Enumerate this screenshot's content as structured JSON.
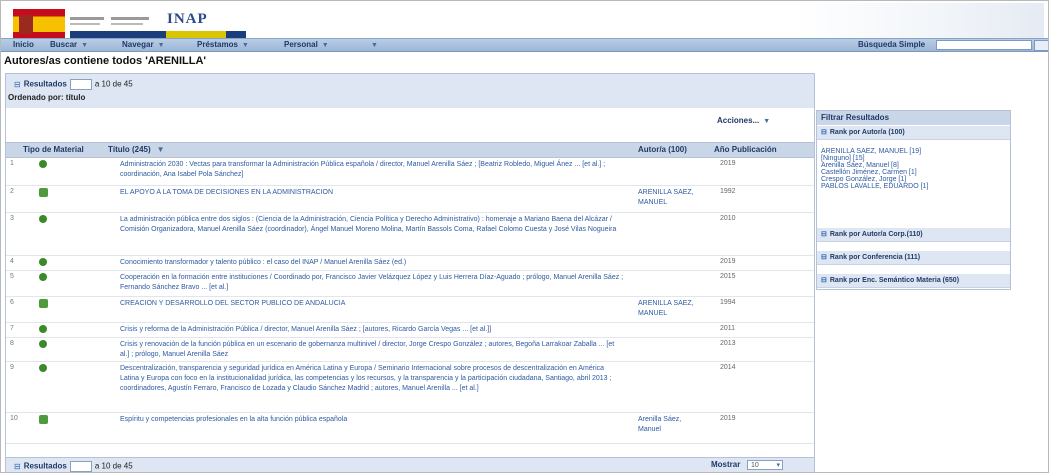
{
  "header": {
    "app_title": "INAP",
    "nav": [
      {
        "label": "Inicio",
        "dropdown": false
      },
      {
        "label": "Buscar",
        "dropdown": true
      },
      {
        "label": "Navegar",
        "dropdown": true
      },
      {
        "label": "Préstamos",
        "dropdown": true
      },
      {
        "label": "Personal",
        "dropdown": true
      },
      {
        "label": "",
        "dropdown": true
      }
    ],
    "dropdown_glyph": "▼",
    "search_label": "Búsqueda Simple",
    "search_value": ""
  },
  "page": {
    "heading": "Autores/as contiene todos 'ARENILLA'"
  },
  "results": {
    "collapse_glyph": "⊟",
    "label": "Resultados",
    "page_value": "1",
    "range": "a 10 de 45",
    "ordered_by": "Ordenado por: título",
    "actions_label": "Acciones..."
  },
  "table": {
    "headers": {
      "material": "Tipo de Material",
      "title": "Título (245)",
      "author": "Autor/a (100)",
      "year": "Año Publicación"
    },
    "rows": [
      {
        "num": "1",
        "icon": "book-icon",
        "title": "Administración 2030 : Vectas para transformar la Administración Pública española / director, Manuel Arenilla Sáez ; [Beatriz Robledo, Miguel Ánez ... [et al.] ; coordinación, Ana Isabel Pola Sánchez]",
        "author": "",
        "year": "2019"
      },
      {
        "num": "2",
        "icon": "printed-icon",
        "title": "EL APOYO A LA TOMA DE DECISIONES EN LA ADMINISTRACION",
        "author": "ARENILLA SAEZ, MANUEL",
        "year": "1992"
      },
      {
        "num": "3",
        "icon": "book-icon",
        "title": "La administración pública entre dos siglos : (Ciencia de la Administración, Ciencia Política y Derecho Administrativo) : homenaje a Mariano Baena del Alcázar / Comisión Organizadora, Manuel Arenilla Sáez (coordinador), Ángel Manuel Moreno Molina, Martín Bassols Coma, Rafael Colomo Cuesta y José Vilas Nogueira",
        "author": "",
        "year": "2010"
      },
      {
        "num": "4",
        "icon": "book-icon",
        "title": "Conocimiento transformador y talento público : el caso del INAP / Manuel Arenilla Sáez (ed.)",
        "author": "",
        "year": "2019"
      },
      {
        "num": "5",
        "icon": "book-icon",
        "title": "Cooperación en la formación entre instituciones / Coordinado por, Francisco Javier Velázquez López y Luis Herrera Díaz-Aguado ; prólogo, Manuel Arenilla Sáez ; Fernando Sánchez Bravo ... [et al.]",
        "author": "",
        "year": "2015"
      },
      {
        "num": "6",
        "icon": "printed-icon",
        "title": "CREACION Y DESARROLLO DEL SECTOR PUBLICO DE ANDALUCIA",
        "author": "ARENILLA SAEZ, MANUEL",
        "year": "1994"
      },
      {
        "num": "7",
        "icon": "book-icon",
        "title": "Crisis y reforma de la Administración Pública / director, Manuel Arenilla Sáez ; [autores, Ricardo García Vegas ... [et al.]]",
        "author": "",
        "year": "2011"
      },
      {
        "num": "8",
        "icon": "book-icon",
        "title": "Crisis y renovación de la función pública en un escenario de gobernanza multinivel / director, Jorge Crespo González ; autores, Begoña Larrakoar Zaballa ... [et al.] ; prólogo, Manuel Arenilla Sáez",
        "author": "",
        "year": "2013"
      },
      {
        "num": "9",
        "icon": "book-icon",
        "title": "Descentralización, transparencia y seguridad jurídica en América Latina y Europa / Seminario Internacional sobre procesos de descentralización en América Latina y Europa con foco en la institucionalidad jurídica, las competencias y los recursos, y la transparencia y la participación ciudadana, Santiago, abril 2013 ; coordinadores, Agustín Ferraro, Francisco de Lozada y Claudio Sánchez Madrid ; autores, Manuel Arenilla ... [et al.]",
        "author": "",
        "year": "2014"
      },
      {
        "num": "10",
        "icon": "printed-icon",
        "title": "Espíritu y competencias profesionales en la alta función pública española",
        "author": "Arenilla Sáez, Manuel",
        "year": "2019"
      }
    ]
  },
  "pagination": {
    "show_label": "Mostrar",
    "show_value": "10",
    "select_arrow": "▾"
  },
  "filters": {
    "title": "Filtrar Resultados",
    "sections": [
      {
        "label": "Rank por Autor/a (100)"
      },
      {
        "label": "Rank por Autor/a Corp.(110)"
      },
      {
        "label": "Rank por Conferencia (111)"
      },
      {
        "label": "Rank por Enc. Semántico Materia (650)"
      }
    ],
    "author_items": [
      "ARENILLA SAEZ, MANUEL [19]",
      "[Ninguno] [15]",
      "Arenilla Sáez, Manuel [8]",
      "Castellón Jiménez, Carmen [1]",
      "Crespo González, Jorge [1]",
      "PABLOS LAVALLE, EDUARDO [1]"
    ]
  },
  "colors": {
    "nav_bg": "#9db6d6",
    "link": "#2d5aa0",
    "panel_header": "#c9d6e8",
    "icon_green": "#3a8a2a"
  }
}
